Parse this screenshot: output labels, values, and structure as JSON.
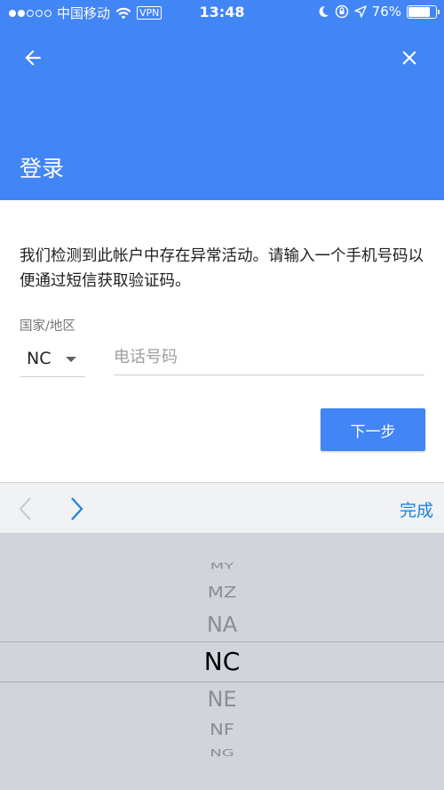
{
  "status_bar": {
    "carrier": "中国移动",
    "vpn": "VPN",
    "time": "13:48",
    "battery": "76%",
    "battery_level": 0.76
  },
  "header": {
    "title": "登录"
  },
  "main": {
    "message": "我们检测到此帐户中存在异常活动。请输入一个手机号码以便通过短信获取验证码。",
    "country_label": "国家/地区",
    "country_value": "NC",
    "phone_placeholder": "电话号码",
    "next_button": "下一步"
  },
  "keyboard_toolbar": {
    "done": "完成"
  },
  "picker": {
    "options": [
      "MY",
      "MZ",
      "NA",
      "NC",
      "NE",
      "NF",
      "NG"
    ],
    "selected": "NC"
  },
  "colors": {
    "accent": "#4285f4",
    "done_link": "#1a82e2",
    "picker_bg": "#d1d4da"
  }
}
